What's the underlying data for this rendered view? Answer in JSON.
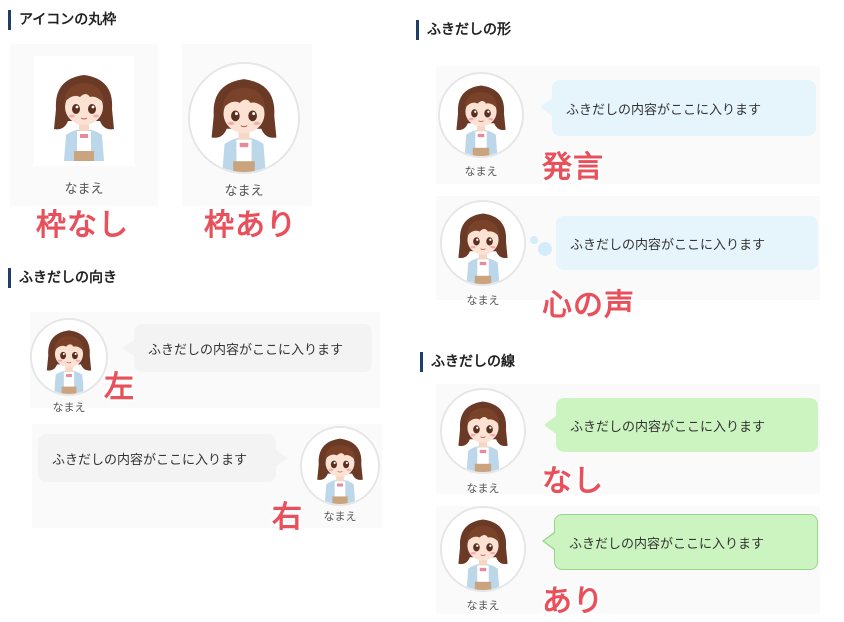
{
  "sections": {
    "icon_frame": "アイコンの丸枠",
    "direction": "ふきだしの向き",
    "shape": "ふきだしの形",
    "line": "ふきだしの線"
  },
  "avatar_name": "なまえ",
  "bubble_text": "ふきだしの内容がここに入ります",
  "captions": {
    "no_frame": "枠なし",
    "with_frame": "枠あり",
    "left": "左",
    "right": "右",
    "speech": "発言",
    "thought": "心の声",
    "no_line": "なし",
    "with_line": "あり"
  },
  "colors": {
    "accent_caption": "#e8505b",
    "heading_bar": "#1f3f66",
    "bubble_gray": "#f3f3f3",
    "bubble_blue": "#e6f4fc",
    "bubble_green": "#cbf4c0"
  },
  "icons": [
    "girl-avatar-icon"
  ]
}
